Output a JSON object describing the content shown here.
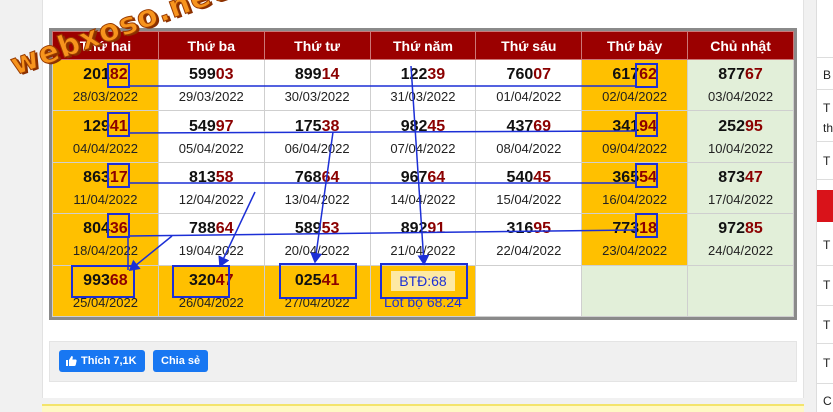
{
  "watermark": "webxoso.net",
  "table": {
    "headers": [
      "Thứ hai",
      "Thứ ba",
      "Thứ tư",
      "Thứ năm",
      "Thứ sáu",
      "Thứ bảy",
      "Chủ nhật"
    ],
    "rows": [
      [
        {
          "head": "201",
          "tail": "82",
          "date": "28/03/2022",
          "style": "hl"
        },
        {
          "head": "599",
          "tail": "03",
          "date": "29/03/2022",
          "style": ""
        },
        {
          "head": "899",
          "tail": "14",
          "date": "30/03/2022",
          "style": ""
        },
        {
          "head": "122",
          "tail": "39",
          "date": "31/03/2022",
          "style": ""
        },
        {
          "head": "760",
          "tail": "07",
          "date": "01/04/2022",
          "style": ""
        },
        {
          "head": "617",
          "tail": "62",
          "date": "02/04/2022",
          "style": "hl"
        },
        {
          "head": "877",
          "tail": "67",
          "date": "03/04/2022",
          "style": "gr"
        }
      ],
      [
        {
          "head": "129",
          "tail": "41",
          "date": "04/04/2022",
          "style": "hl"
        },
        {
          "head": "549",
          "tail": "97",
          "date": "05/04/2022",
          "style": ""
        },
        {
          "head": "175",
          "tail": "38",
          "date": "06/04/2022",
          "style": ""
        },
        {
          "head": "982",
          "tail": "45",
          "date": "07/04/2022",
          "style": ""
        },
        {
          "head": "437",
          "tail": "69",
          "date": "08/04/2022",
          "style": ""
        },
        {
          "head": "341",
          "tail": "94",
          "date": "09/04/2022",
          "style": "hl"
        },
        {
          "head": "252",
          "tail": "95",
          "date": "10/04/2022",
          "style": "gr"
        }
      ],
      [
        {
          "head": "863",
          "tail": "17",
          "date": "11/04/2022",
          "style": "hl"
        },
        {
          "head": "813",
          "tail": "58",
          "date": "12/04/2022",
          "style": ""
        },
        {
          "head": "768",
          "tail": "64",
          "date": "13/04/2022",
          "style": ""
        },
        {
          "head": "967",
          "tail": "64",
          "date": "14/04/2022",
          "style": ""
        },
        {
          "head": "540",
          "tail": "45",
          "date": "15/04/2022",
          "style": ""
        },
        {
          "head": "365",
          "tail": "54",
          "date": "16/04/2022",
          "style": "hl"
        },
        {
          "head": "873",
          "tail": "47",
          "date": "17/04/2022",
          "style": "gr"
        }
      ],
      [
        {
          "head": "804",
          "tail": "36",
          "date": "18/04/2022",
          "style": "hl"
        },
        {
          "head": "788",
          "tail": "64",
          "date": "19/04/2022",
          "style": ""
        },
        {
          "head": "589",
          "tail": "53",
          "date": "20/04/2022",
          "style": ""
        },
        {
          "head": "892",
          "tail": "91",
          "date": "21/04/2022",
          "style": ""
        },
        {
          "head": "316",
          "tail": "95",
          "date": "22/04/2022",
          "style": ""
        },
        {
          "head": "773",
          "tail": "18",
          "date": "23/04/2022",
          "style": "hl"
        },
        {
          "head": "972",
          "tail": "85",
          "date": "24/04/2022",
          "style": "gr"
        }
      ],
      [
        {
          "head": "993",
          "tail": "68",
          "date": "25/04/2022",
          "style": "hl"
        },
        {
          "head": "320",
          "tail": "47",
          "date": "26/04/2022",
          "style": "hl"
        },
        {
          "head": "025",
          "tail": "41",
          "date": "27/04/2022",
          "style": "hl"
        },
        {
          "btd": "BTĐ:68",
          "lot": "Lót bộ 68.24",
          "style": "hl"
        },
        {
          "empty": true,
          "style": ""
        },
        {
          "empty": true,
          "style": "gr"
        },
        {
          "empty": true,
          "style": "gr"
        }
      ]
    ]
  },
  "share": {
    "like_label": "Thích 7,1K",
    "share_label": "Chia sẻ"
  },
  "sidebar": {
    "letters": [
      "",
      "B",
      "T",
      "th",
      "T",
      "T",
      "T",
      "T",
      "T",
      "C"
    ]
  },
  "colors": {
    "header_bg": "#9b0000",
    "highlight": "#ffc000",
    "sunday_bg": "#e2efd9",
    "tail_color": "#8b0000",
    "annotation": "#1c2fd6",
    "facebook": "#1877f2"
  }
}
